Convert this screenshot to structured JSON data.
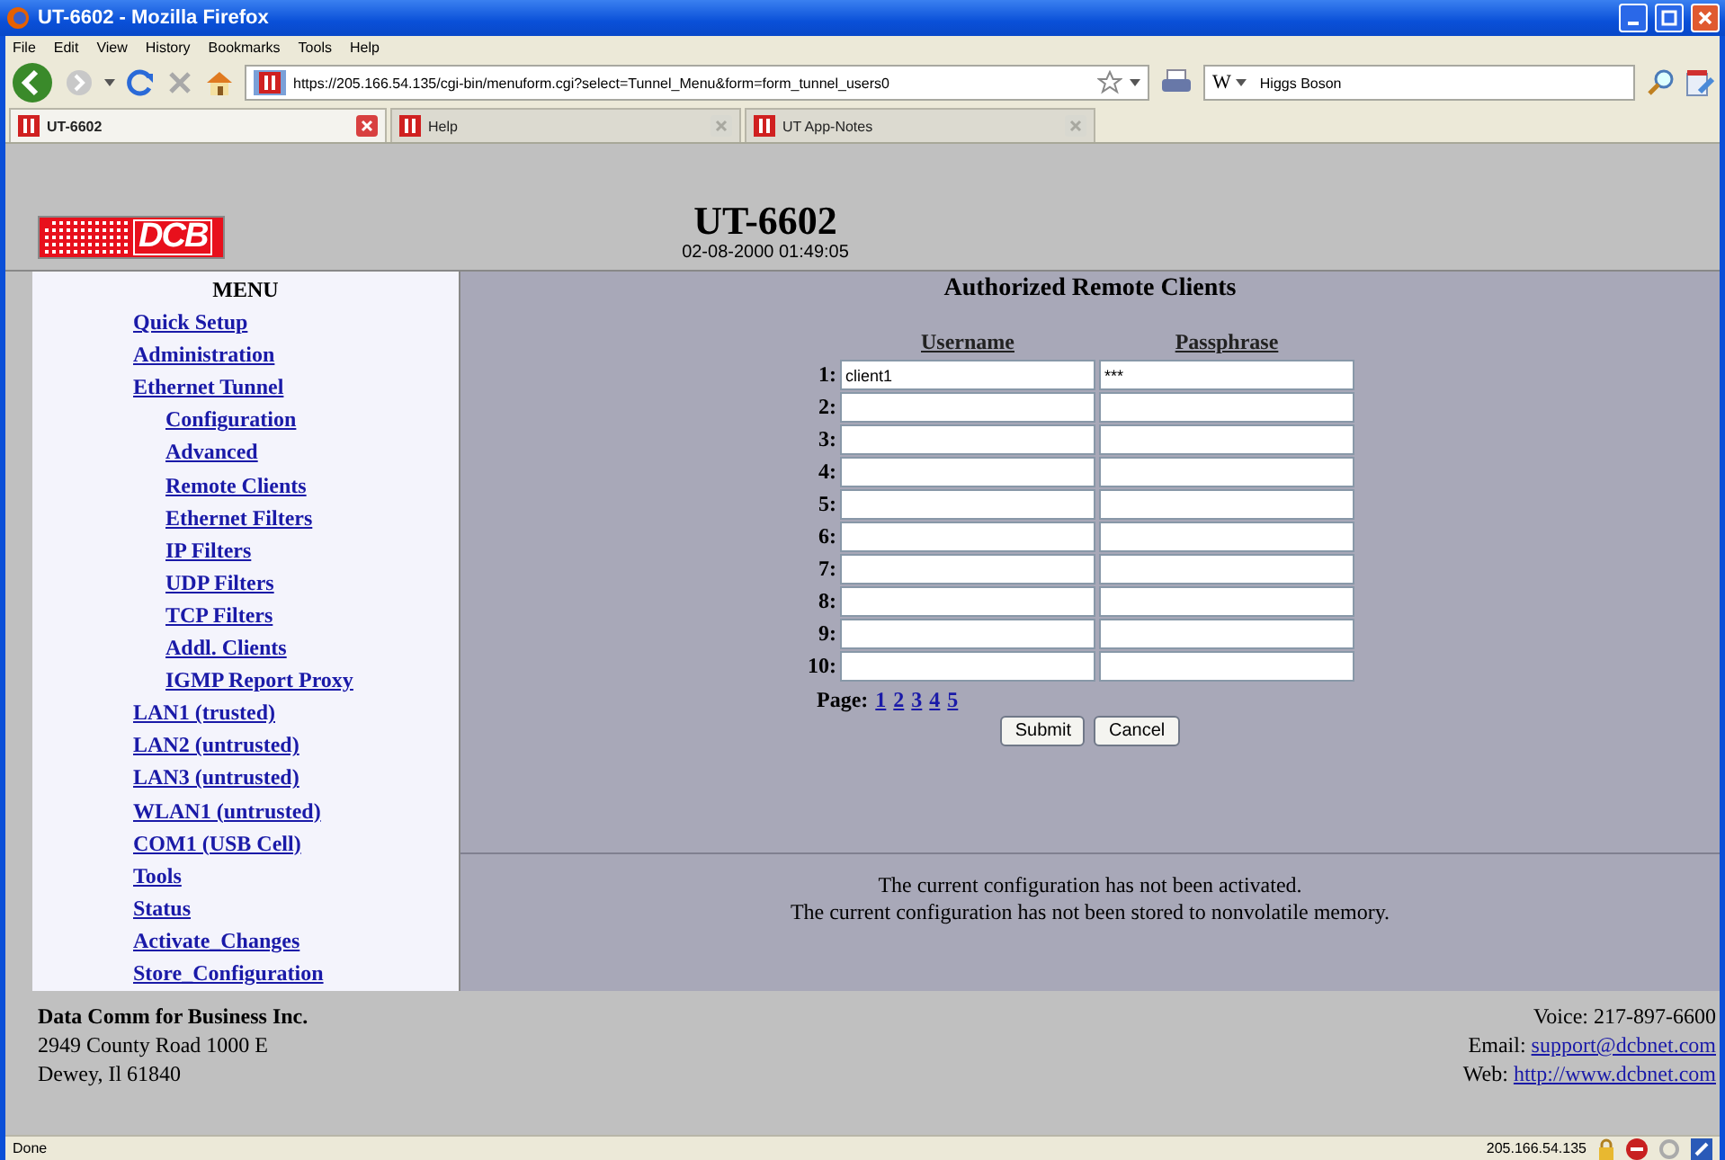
{
  "window": {
    "title": "UT-6602 - Mozilla Firefox"
  },
  "menu_bar": [
    "File",
    "Edit",
    "View",
    "History",
    "Bookmarks",
    "Tools",
    "Help"
  ],
  "address_bar": {
    "url": "https://205.166.54.135/cgi-bin/menuform.cgi?select=Tunnel_Menu&form=form_tunnel_users0"
  },
  "search_bar": {
    "engine": "W",
    "value": "Higgs Boson"
  },
  "tabs": [
    {
      "label": "UT-6602",
      "selected": true
    },
    {
      "label": "Help",
      "selected": false
    },
    {
      "label": "UT App-Notes",
      "selected": false
    }
  ],
  "page": {
    "logo": "DCB",
    "device": "UT-6602",
    "datetime": "02-08-2000 01:49:05",
    "menu_title": "MENU",
    "menu": [
      {
        "label": "Quick Setup"
      },
      {
        "label": "Administration"
      },
      {
        "label": "Ethernet Tunnel",
        "children": [
          {
            "label": "Configuration"
          },
          {
            "label": "Advanced"
          },
          {
            "label": "Remote Clients"
          },
          {
            "label": "Ethernet Filters"
          },
          {
            "label": "IP Filters"
          },
          {
            "label": "UDP Filters"
          },
          {
            "label": "TCP Filters"
          },
          {
            "label": "Addl. Clients"
          },
          {
            "label": "IGMP Report Proxy"
          }
        ]
      },
      {
        "label": "LAN1 (trusted)"
      },
      {
        "label": "LAN2 (untrusted)"
      },
      {
        "label": "LAN3 (untrusted)"
      },
      {
        "label": "WLAN1 (untrusted)"
      },
      {
        "label": "COM1 (USB Cell)"
      },
      {
        "label": "Tools"
      },
      {
        "label": "Status"
      },
      {
        "label": "Activate_Changes"
      },
      {
        "label": "Store_Configuration"
      }
    ],
    "form_title": "Authorized Remote Clients",
    "columns": [
      "Username",
      "Passphrase"
    ],
    "rows": [
      {
        "index": "1:",
        "username": "client1",
        "passphrase": "***"
      },
      {
        "index": "2:"
      },
      {
        "index": "3:"
      },
      {
        "index": "4:"
      },
      {
        "index": "5:"
      },
      {
        "index": "6:"
      },
      {
        "index": "7:"
      },
      {
        "index": "8:"
      },
      {
        "index": "9:"
      },
      {
        "index": "10:"
      }
    ],
    "pager_label": "Page:",
    "pages": [
      "1",
      "2",
      "3",
      "4",
      "5"
    ],
    "buttons": [
      "Submit",
      "Cancel"
    ],
    "messages": [
      "The current configuration has not been activated.",
      "The current configuration has not been stored to nonvolatile memory."
    ],
    "footer": {
      "company": "Data Comm for Business Inc.",
      "address": [
        "2949 County Road 1000 E",
        "Dewey, Il 61840"
      ],
      "voice_label": "Voice:",
      "voice": "217-897-6600",
      "email_label": "Email:",
      "email": "support@dcbnet.com",
      "web_label": "Web:",
      "web": "http://www.dcbnet.com"
    }
  },
  "status_bar": {
    "text": "Done",
    "ip": "205.166.54.135"
  }
}
